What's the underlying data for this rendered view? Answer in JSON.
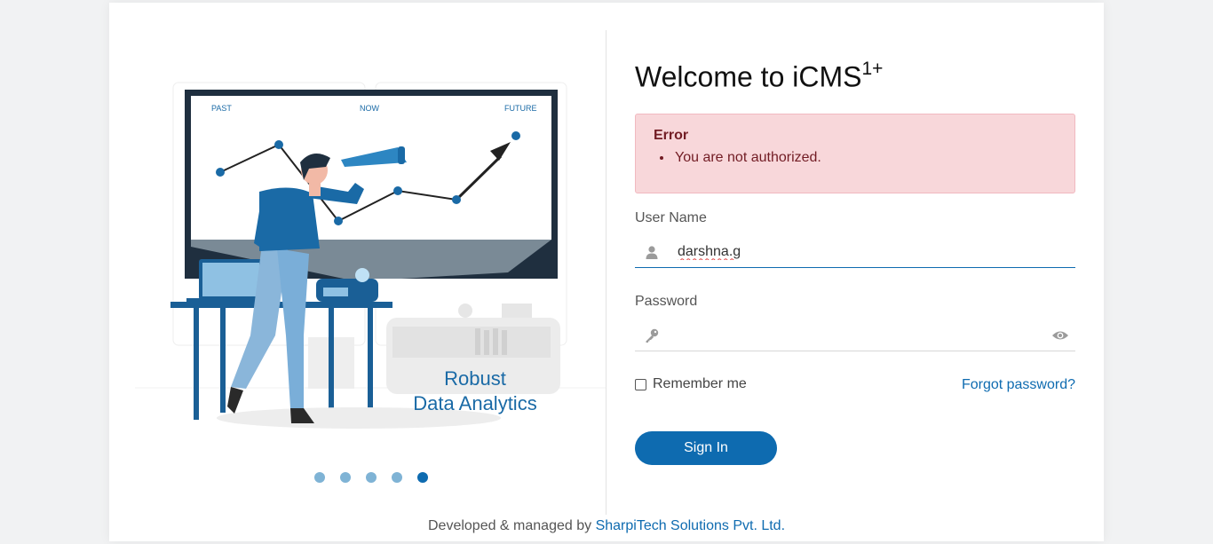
{
  "login": {
    "title": "Welcome to iCMS",
    "title_sup": "1+",
    "error": {
      "heading": "Error",
      "messages": [
        "You are not authorized."
      ]
    },
    "username_label": "User Name",
    "username_value": "darshna.g",
    "password_label": "Password",
    "password_value": "",
    "remember_label": "Remember me",
    "remember_checked": false,
    "forgot_label": "Forgot password?",
    "signin_label": "Sign In"
  },
  "carousel": {
    "slide_caption_line1": "Robust",
    "slide_caption_line2": "Data Analytics",
    "chart_labels": [
      "PAST",
      "NOW",
      "FUTURE"
    ],
    "slide_count": 5,
    "active_slide": 5
  },
  "footer": {
    "prefix": "Developed & managed by ",
    "company": "SharpiTech Solutions Pvt. Ltd."
  },
  "colors": {
    "accent": "#0e6bb0",
    "error_bg": "#f8d7da",
    "error_text": "#721c24"
  }
}
